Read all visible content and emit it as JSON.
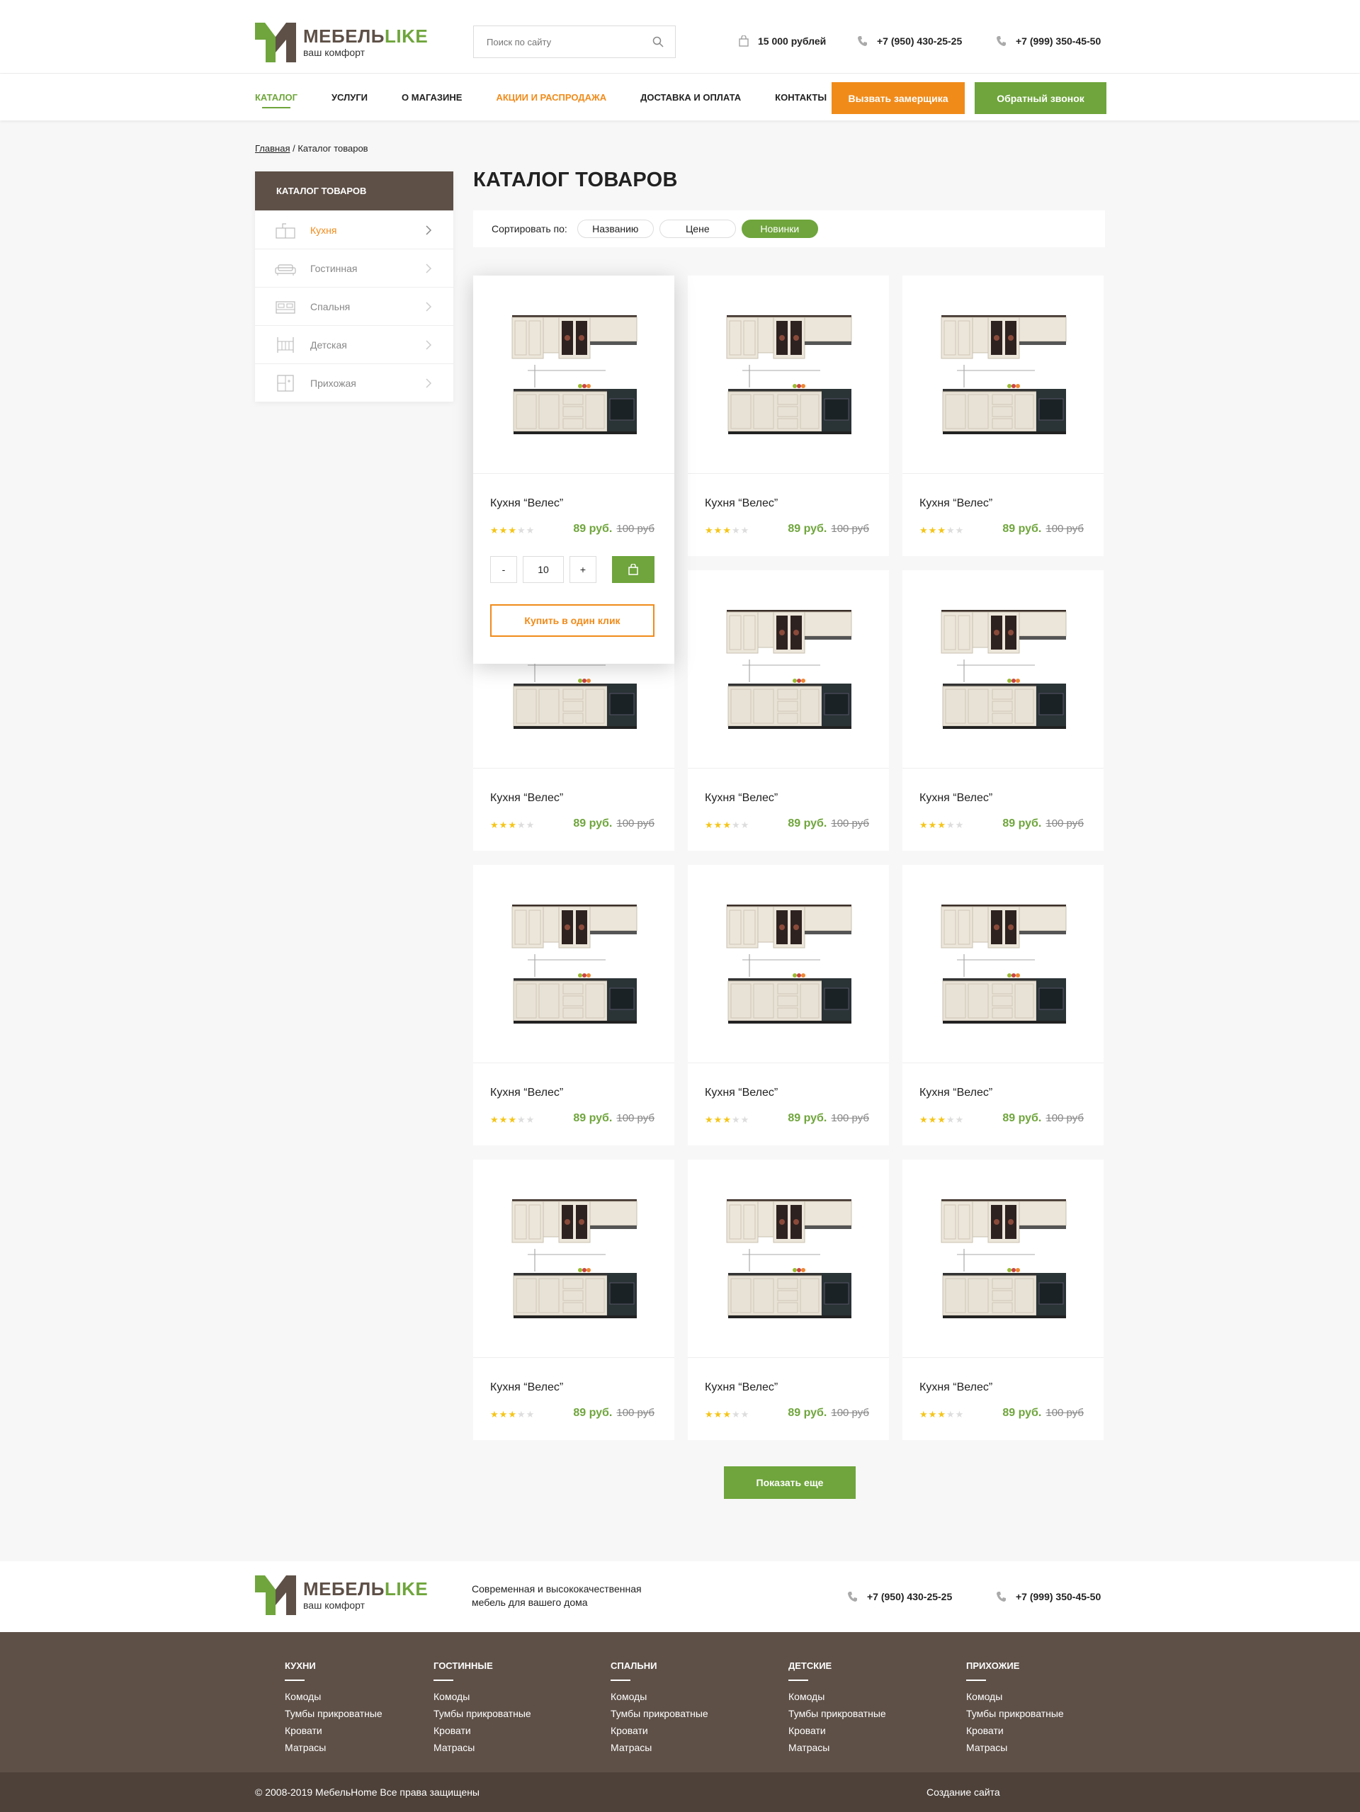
{
  "header": {
    "brand_main": "МЕБЕЛЬ",
    "brand_accent": "LIKE",
    "slogan": "ваш комфорт",
    "search_placeholder": "Поиск по сайту",
    "cart_sum": "15 000 рублей",
    "phone1": "+7 (950) 430-25-25",
    "phone2": "+7 (999) 350-45-50"
  },
  "nav": {
    "items": [
      "Каталог",
      "Услуги",
      "О магазине",
      "Акции и распродажа",
      "Доставка и оплата",
      "Контакты"
    ],
    "measure_button": "Вызвать замерщика",
    "callback_button": "Обратный звонок"
  },
  "breadcrumb": {
    "home": "Главная",
    "sep": " / ",
    "current": "Каталог товаров"
  },
  "sidebar": {
    "title": "Каталог товаров",
    "items": [
      {
        "label": "Кухня",
        "icon": "kitchen-icon"
      },
      {
        "label": "Гостинная",
        "icon": "sofa-icon"
      },
      {
        "label": "Спальня",
        "icon": "bed-icon"
      },
      {
        "label": "Детская",
        "icon": "crib-icon"
      },
      {
        "label": "Прихожая",
        "icon": "wardrobe-icon"
      }
    ]
  },
  "catalog": {
    "title": "КАТАЛОГ ТОВАРОВ",
    "sort_label": "Сортировать по:",
    "sort_options": [
      "Названию",
      "Цене",
      "Новинки"
    ],
    "active_sort": "Новинки",
    "product": {
      "name": "Кухня “Велес”",
      "rating": 3,
      "rating_max": 5,
      "price": "89 руб.",
      "old_price": "100 руб"
    },
    "hover_card": {
      "qty_minus": "-",
      "qty_value": "10",
      "qty_plus": "+",
      "one_click": "Купить в один клик"
    },
    "show_more": "Показать еще"
  },
  "footer": {
    "about": "Современная и высококачественная мебель для вашего дома",
    "phone1": "+7 (950) 430-25-25",
    "phone2": "+7 (999) 350-45-50",
    "columns": [
      {
        "title": "Кухни",
        "links": [
          "Комоды",
          "Тумбы прикроватные",
          "Кровати",
          "Матрасы"
        ]
      },
      {
        "title": "Гостинные",
        "links": [
          "Комоды",
          "Тумбы прикроватные",
          "Кровати",
          "Матрасы"
        ]
      },
      {
        "title": "Спальни",
        "links": [
          "Комоды",
          "Тумбы прикроватные",
          "Кровати",
          "Матрасы"
        ]
      },
      {
        "title": "Детские",
        "links": [
          "Комоды",
          "Тумбы прикроватные",
          "Кровати",
          "Матрасы"
        ]
      },
      {
        "title": "Прихожие",
        "links": [
          "Комоды",
          "Тумбы прикроватные",
          "Кровати",
          "Матрасы"
        ]
      }
    ],
    "copyright": "© 2008-2019 МебельHome Все права защищены",
    "credit": "Создание сайта"
  },
  "colors": {
    "accent_green": "#6fa53c",
    "accent_orange": "#f08b1a",
    "brown": "#5e5047"
  }
}
